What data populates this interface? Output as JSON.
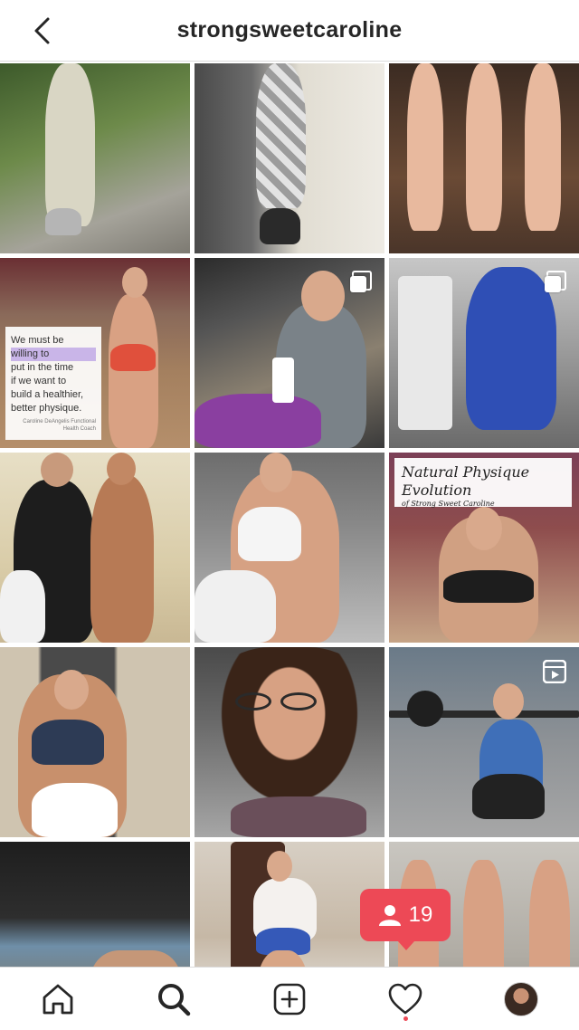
{
  "header": {
    "username": "strongsweetcaroline",
    "back_icon": "chevron-left-icon"
  },
  "posts": [
    {
      "kind": "photo"
    },
    {
      "kind": "photo"
    },
    {
      "kind": "photo"
    },
    {
      "kind": "photo",
      "overlay_lines": [
        "We must be",
        "willing to",
        "put in the time",
        "if we want to",
        "build a healthier,",
        "better physique."
      ],
      "overlay_credit": "Caroline DeAngelis Functional Health Coach"
    },
    {
      "kind": "carousel"
    },
    {
      "kind": "carousel"
    },
    {
      "kind": "photo"
    },
    {
      "kind": "photo"
    },
    {
      "kind": "photo",
      "card_title": "Natural Physique Evolution",
      "card_subtitle": "of Strong Sweet Caroline"
    },
    {
      "kind": "photo"
    },
    {
      "kind": "photo"
    },
    {
      "kind": "video"
    },
    {
      "kind": "photo"
    },
    {
      "kind": "photo"
    },
    {
      "kind": "photo"
    }
  ],
  "notification": {
    "count": "19",
    "icon": "person-icon",
    "color": "#ed4956"
  },
  "tabbar": {
    "items": [
      {
        "name": "home",
        "icon": "home-icon"
      },
      {
        "name": "search",
        "icon": "search-icon",
        "active": true
      },
      {
        "name": "new-post",
        "icon": "plus-square-icon"
      },
      {
        "name": "activity",
        "icon": "heart-icon",
        "has_dot": true
      },
      {
        "name": "profile",
        "icon": "avatar"
      }
    ]
  },
  "colors": {
    "accent": "#ed4956",
    "text": "#262626",
    "divider": "#dbdbdb"
  }
}
